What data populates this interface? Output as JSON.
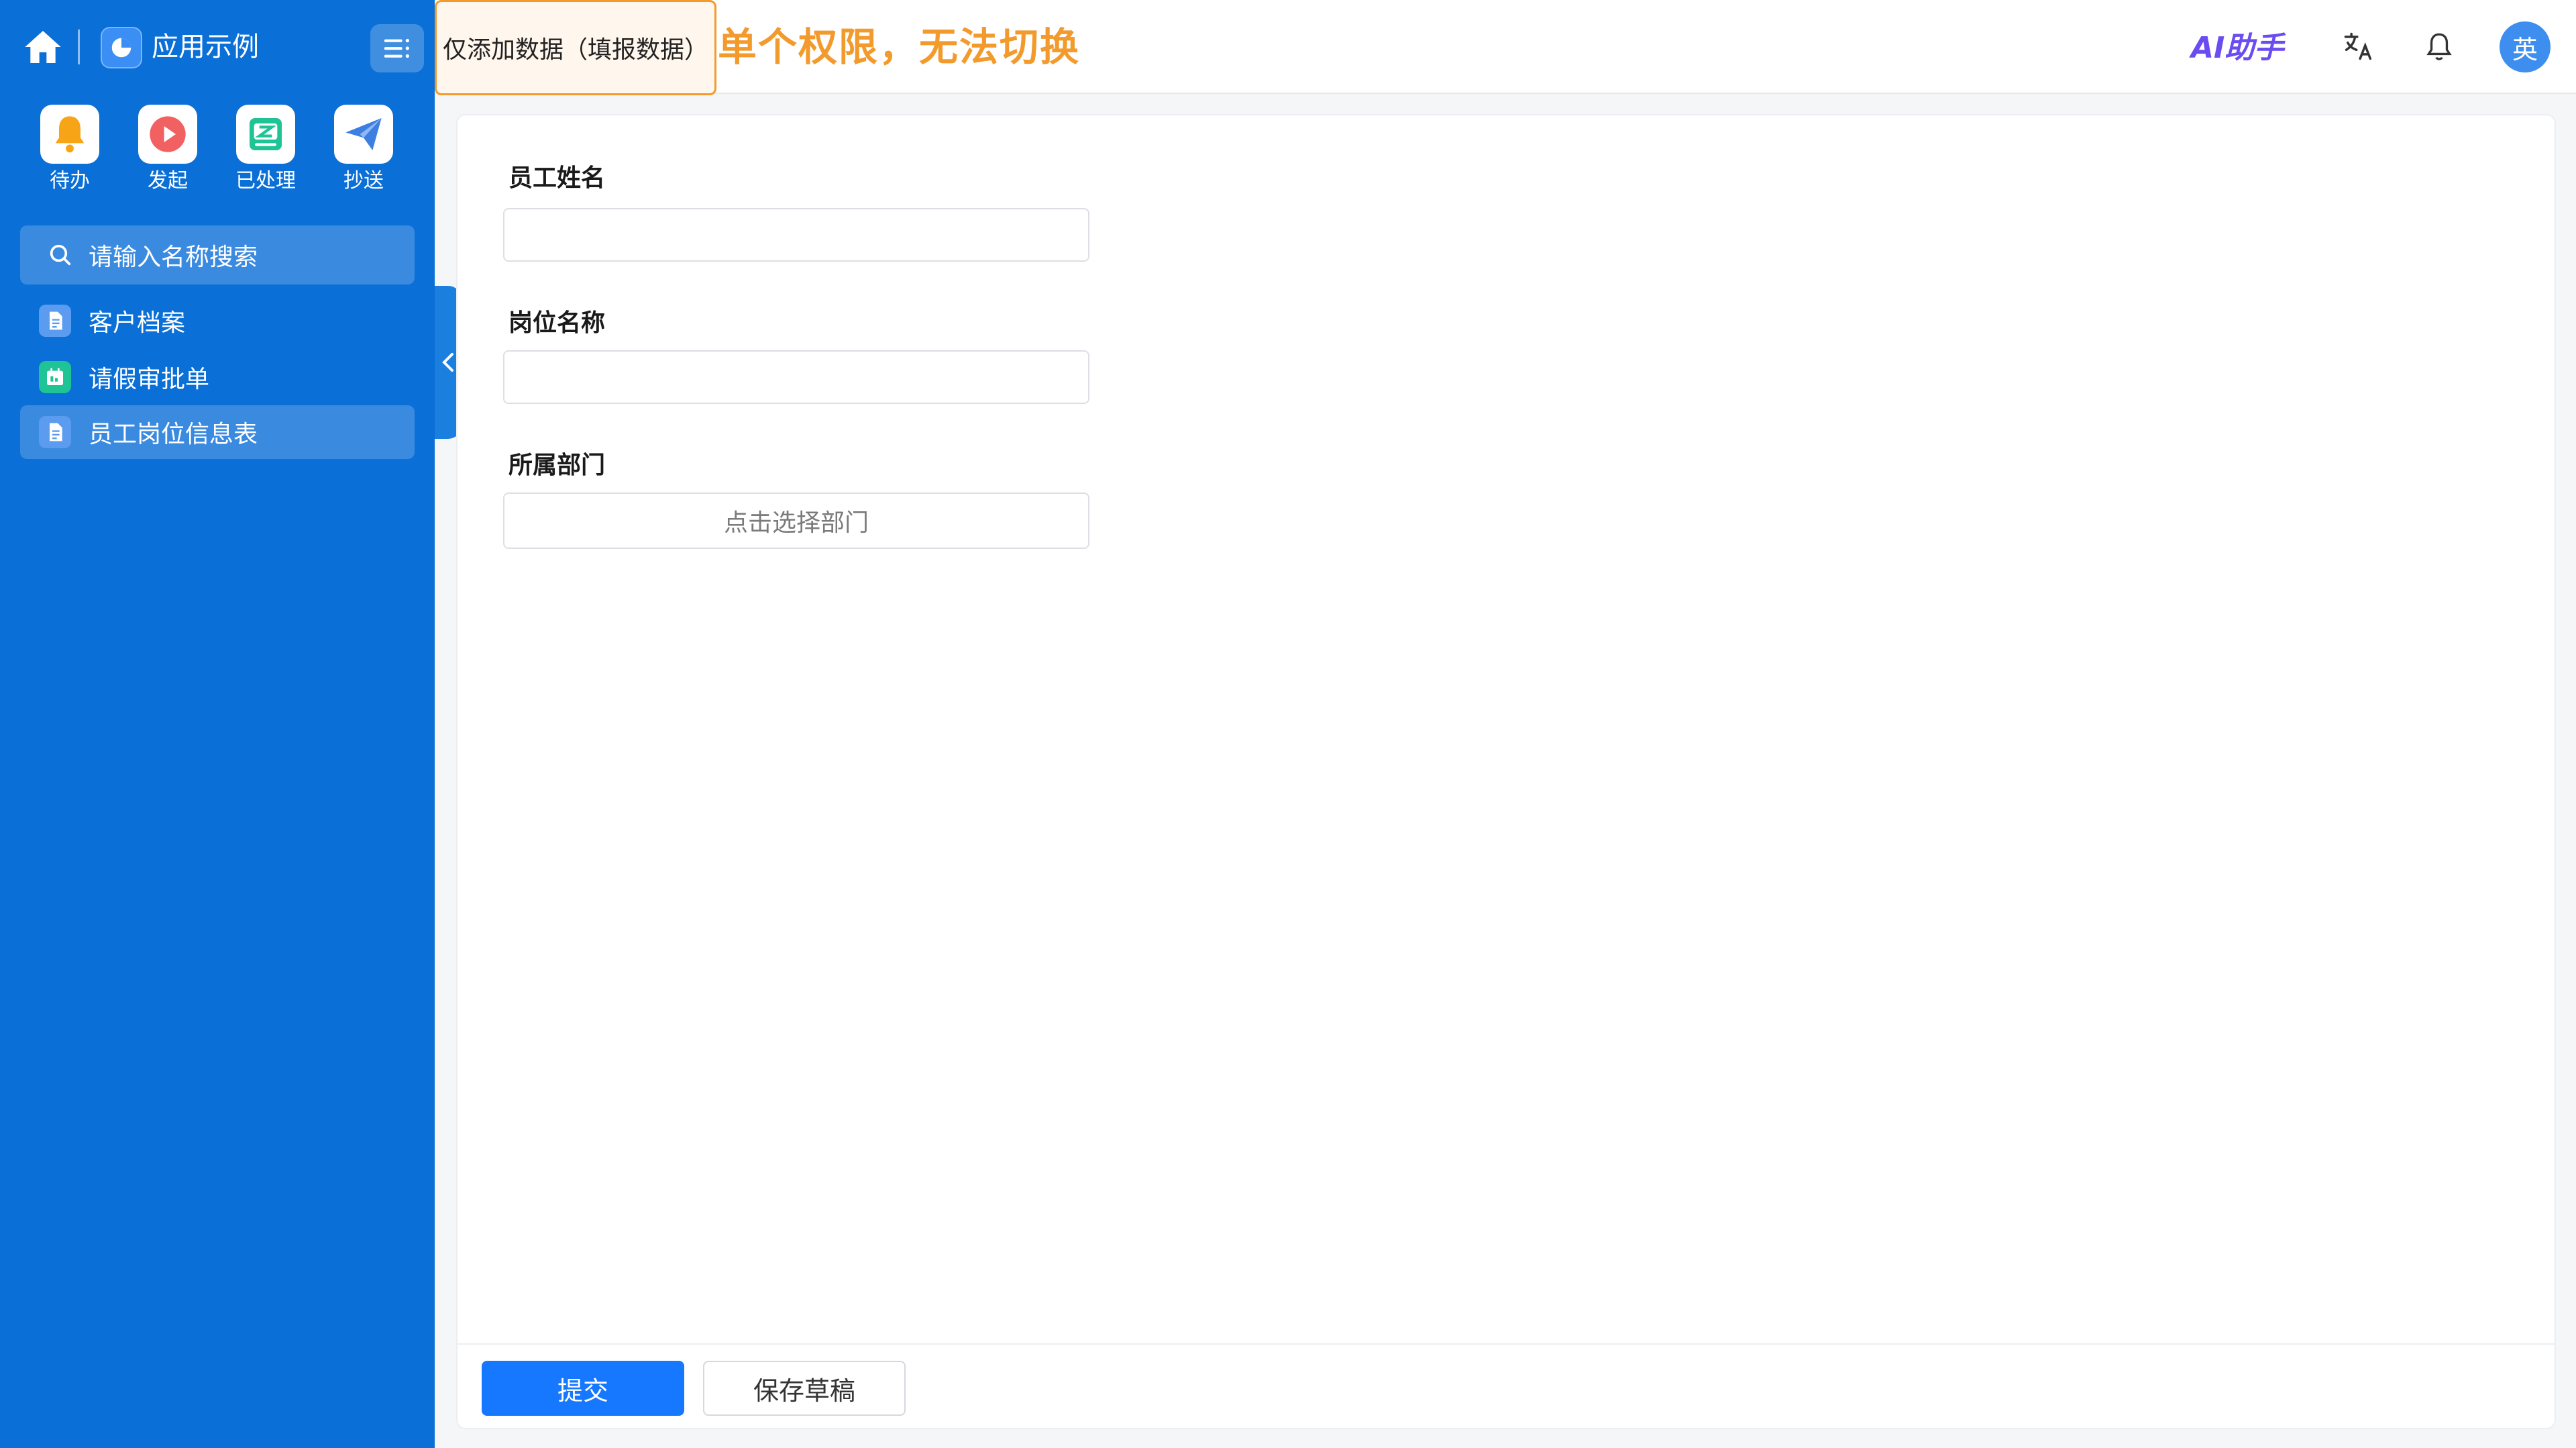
{
  "sidebar": {
    "brand_name": "应用示例",
    "quick_actions": [
      {
        "label": "待办",
        "icon": "bell-icon",
        "color": "#f7a416"
      },
      {
        "label": "发起",
        "icon": "play-icon",
        "color": "#f26161"
      },
      {
        "label": "已处理",
        "icon": "edit-box-icon",
        "color": "#1ec495"
      },
      {
        "label": "抄送",
        "icon": "paper-plane-icon",
        "color": "#3d7fe0"
      }
    ],
    "search_placeholder": "请输入名称搜索",
    "items": [
      {
        "label": "客户档案",
        "icon": "document-icon",
        "active": false
      },
      {
        "label": "请假审批单",
        "icon": "calendar-icon",
        "active": false
      },
      {
        "label": "员工岗位信息表",
        "icon": "document-icon",
        "active": true
      }
    ]
  },
  "header": {
    "permission_tab": "仅添加数据（填报数据）",
    "permission_note": "单个权限，无法切换",
    "ai_assistant": "AI助手",
    "avatar_text": "英"
  },
  "form": {
    "fields": [
      {
        "label": "员工姓名",
        "value": ""
      },
      {
        "label": "岗位名称",
        "value": ""
      },
      {
        "label": "所属部门",
        "button_text": "点击选择部门"
      }
    ],
    "submit_label": "提交",
    "draft_label": "保存草稿"
  },
  "colors": {
    "sidebar_bg": "#0a6fd6",
    "accent": "#1677ff",
    "note_orange": "#f39a2c"
  }
}
